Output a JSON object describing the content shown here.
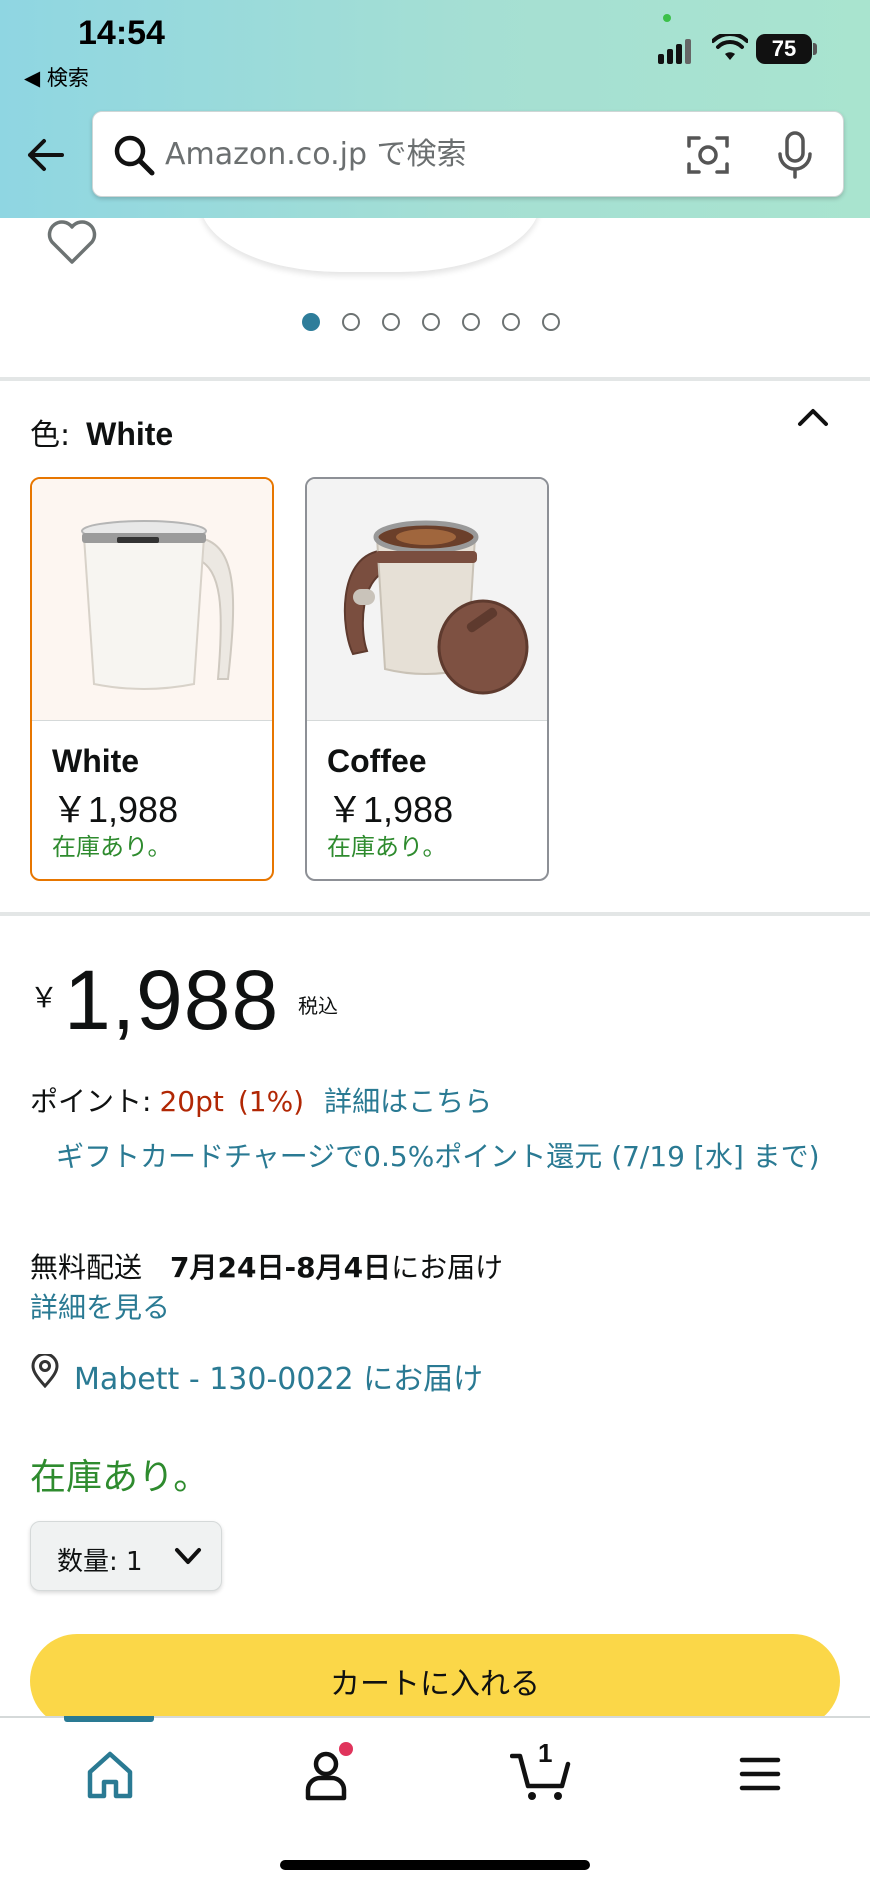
{
  "status_bar": {
    "time": "14:54",
    "back_app": "◀ 検索",
    "battery": "75"
  },
  "search": {
    "placeholder": "Amazon.co.jp で検索"
  },
  "carousel": {
    "page_count": 7,
    "active_index": 0
  },
  "color": {
    "label": "色:",
    "selected": "White",
    "options": [
      {
        "name": "White",
        "price": "￥1,988",
        "stock": "在庫あり。"
      },
      {
        "name": "Coffee",
        "price": "￥1,988",
        "stock": "在庫あり。"
      }
    ]
  },
  "price": {
    "symbol": "￥",
    "amount": "1,988",
    "tax_note": "税込"
  },
  "points": {
    "label": "ポイント:",
    "value": "20pt",
    "percent": "(1%)",
    "details_link": "詳細はこちら"
  },
  "gift_card_promo": "ギフトカードチャージで0.5%ポイント還元 (7/19 [水] まで)",
  "delivery": {
    "label": "無料配送",
    "date": "7月24日-8月4日",
    "suffix": "にお届け",
    "details_link": "詳細を見る"
  },
  "location": "Mabett - 130-0022 にお届け",
  "stock_status": "在庫あり。",
  "quantity": {
    "label": "数量: 1"
  },
  "cart_button": "カートに入れる",
  "bottom_nav": {
    "cart_count": "1",
    "active": "home"
  },
  "colors": {
    "accent_link": "#2a7a93",
    "price_red": "#b12704",
    "stock_green": "#2e8b2e",
    "cart_yellow": "#fbd748",
    "selected_border": "#e77600"
  }
}
